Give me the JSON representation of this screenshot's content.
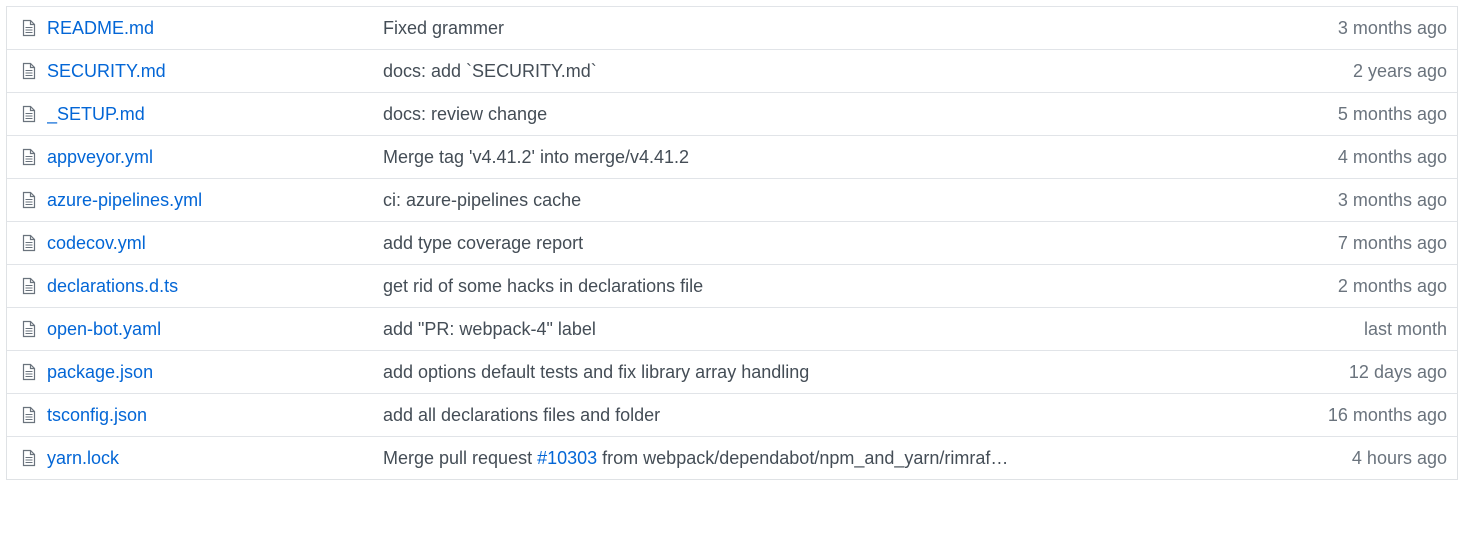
{
  "colors": {
    "link": "#0366d6",
    "message": "#444d56",
    "age": "#6a737d",
    "border": "#e1e4e8",
    "icon": "#6a737d"
  },
  "files": [
    {
      "icon": "file-text-icon",
      "name": "README.md",
      "message": "Fixed grammer",
      "age": "3 months ago"
    },
    {
      "icon": "file-text-icon",
      "name": "SECURITY.md",
      "message": "docs: add `SECURITY.md`",
      "age": "2 years ago"
    },
    {
      "icon": "file-text-icon",
      "name": "_SETUP.md",
      "message": "docs: review change",
      "age": "5 months ago"
    },
    {
      "icon": "file-text-icon",
      "name": "appveyor.yml",
      "message": "Merge tag 'v4.41.2' into merge/v4.41.2",
      "age": "4 months ago"
    },
    {
      "icon": "file-text-icon",
      "name": "azure-pipelines.yml",
      "message": "ci: azure-pipelines cache",
      "age": "3 months ago"
    },
    {
      "icon": "file-text-icon",
      "name": "codecov.yml",
      "message": "add type coverage report",
      "age": "7 months ago"
    },
    {
      "icon": "file-text-icon",
      "name": "declarations.d.ts",
      "message": "get rid of some hacks in declarations file",
      "age": "2 months ago"
    },
    {
      "icon": "file-text-icon",
      "name": "open-bot.yaml",
      "message": "add \"PR: webpack-4\" label",
      "age": "last month"
    },
    {
      "icon": "file-text-icon",
      "name": "package.json",
      "message": "add options default tests and fix library array handling",
      "age": "12 days ago"
    },
    {
      "icon": "file-text-icon",
      "name": "tsconfig.json",
      "message": "add all declarations files and folder",
      "age": "16 months ago"
    },
    {
      "icon": "file-text-icon",
      "name": "yarn.lock",
      "message_prefix": "Merge pull request ",
      "message_link": "#10303",
      "message_suffix": " from webpack/dependabot/npm_and_yarn/rimraf…",
      "age": "4 hours ago"
    }
  ]
}
